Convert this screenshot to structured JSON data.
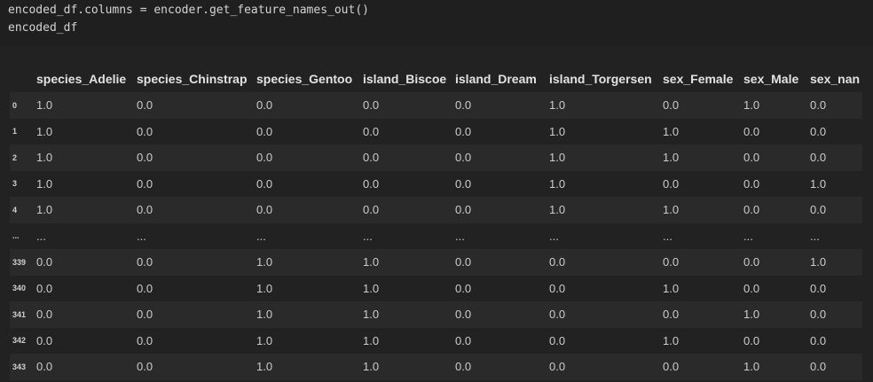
{
  "code": {
    "line1": "encoded_df.columns = encoder.get_feature_names_out()",
    "line2": "encoded_df"
  },
  "table": {
    "columns": [
      "species_Adelie",
      "species_Chinstrap",
      "species_Gentoo",
      "island_Biscoe",
      "island_Dream",
      "island_Torgersen",
      "sex_Female",
      "sex_Male",
      "sex_nan"
    ],
    "rows": [
      {
        "index": "0",
        "values": [
          "1.0",
          "0.0",
          "0.0",
          "0.0",
          "0.0",
          "1.0",
          "0.0",
          "1.0",
          "0.0"
        ]
      },
      {
        "index": "1",
        "values": [
          "1.0",
          "0.0",
          "0.0",
          "0.0",
          "0.0",
          "1.0",
          "1.0",
          "0.0",
          "0.0"
        ]
      },
      {
        "index": "2",
        "values": [
          "1.0",
          "0.0",
          "0.0",
          "0.0",
          "0.0",
          "1.0",
          "1.0",
          "0.0",
          "0.0"
        ]
      },
      {
        "index": "3",
        "values": [
          "1.0",
          "0.0",
          "0.0",
          "0.0",
          "0.0",
          "1.0",
          "0.0",
          "0.0",
          "1.0"
        ]
      },
      {
        "index": "4",
        "values": [
          "1.0",
          "0.0",
          "0.0",
          "0.0",
          "0.0",
          "1.0",
          "1.0",
          "0.0",
          "0.0"
        ]
      },
      {
        "index": "...",
        "values": [
          "...",
          "...",
          "...",
          "...",
          "...",
          "...",
          "...",
          "...",
          "..."
        ]
      },
      {
        "index": "339",
        "values": [
          "0.0",
          "0.0",
          "1.0",
          "1.0",
          "0.0",
          "0.0",
          "0.0",
          "0.0",
          "1.0"
        ]
      },
      {
        "index": "340",
        "values": [
          "0.0",
          "0.0",
          "1.0",
          "1.0",
          "0.0",
          "0.0",
          "1.0",
          "0.0",
          "0.0"
        ]
      },
      {
        "index": "341",
        "values": [
          "0.0",
          "0.0",
          "1.0",
          "1.0",
          "0.0",
          "0.0",
          "0.0",
          "1.0",
          "0.0"
        ]
      },
      {
        "index": "342",
        "values": [
          "0.0",
          "0.0",
          "1.0",
          "1.0",
          "0.0",
          "0.0",
          "1.0",
          "0.0",
          "0.0"
        ]
      },
      {
        "index": "343",
        "values": [
          "0.0",
          "0.0",
          "1.0",
          "1.0",
          "0.0",
          "0.0",
          "0.0",
          "1.0",
          "0.0"
        ]
      }
    ]
  }
}
